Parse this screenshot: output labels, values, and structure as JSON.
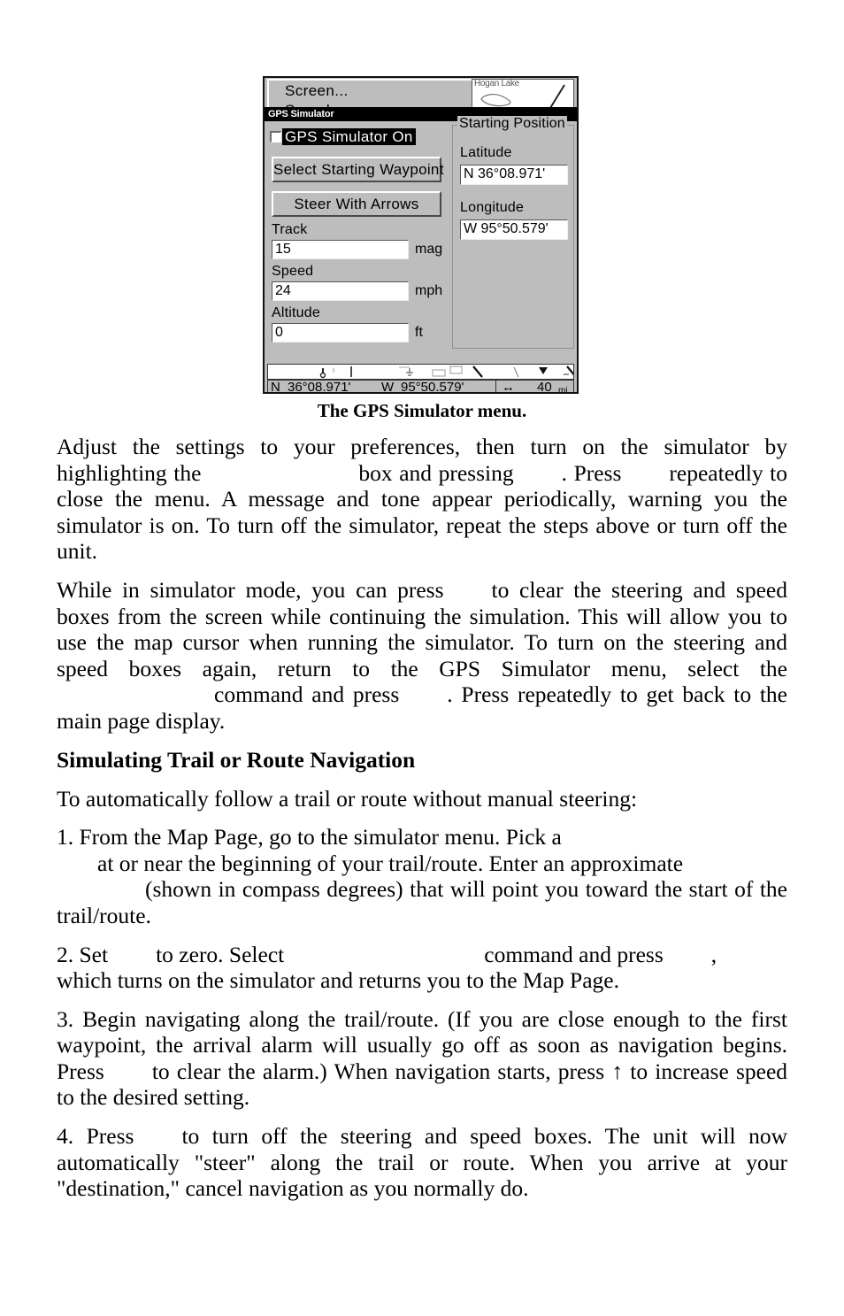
{
  "figure": {
    "background_menu": {
      "items": [
        "Screen...",
        "Sounds..."
      ]
    },
    "map_fragment": {
      "label": "Hogan Lake"
    },
    "dialog": {
      "title": "GPS Simulator",
      "checkbox": {
        "label": "GPS Simulator On",
        "checked": false,
        "highlighted": true
      },
      "buttons": [
        {
          "label": "Select Starting Waypoint"
        },
        {
          "label": "Steer With Arrows"
        }
      ],
      "fields": [
        {
          "label": "Track",
          "value": "15",
          "unit": "mag"
        },
        {
          "label": "Speed",
          "value": "24",
          "unit": "mph"
        },
        {
          "label": "Altitude",
          "value": "0",
          "unit": "ft"
        }
      ],
      "starting_position": {
        "legend": "Starting Position",
        "latitude": {
          "label": "Latitude",
          "value": "N   36°08.971'"
        },
        "longitude": {
          "label": "Longitude",
          "value": "W   95°50.579'"
        }
      }
    },
    "status_bar": {
      "lat_hemisphere": "N",
      "latitude": "36°08.971'",
      "lon_hemisphere": "W",
      "longitude": "95°50.579'",
      "zoom_value": "40",
      "zoom_unit": "mi"
    }
  },
  "caption": "The GPS Simulator menu.",
  "body": {
    "p1_a": "Adjust the settings to your preferences, then turn on the simulator by highlighting the",
    "p1_b": "box and pressing",
    "p1_c": ". Press",
    "p1_d": "repeatedly to close the menu. A message and tone appear periodically, warning you the simulator is on. To turn off the simulator, repeat the steps above or turn off the unit.",
    "p2_a": "While in simulator mode, you can press",
    "p2_b": "to clear the steering and speed boxes from the screen while continuing the simulation. This will allow you to use the map cursor when running the simulator. To turn on the steering and speed boxes again, return to the GPS Simulator menu, select the",
    "p2_c": "command and press",
    "p2_d": ". Press repeatedly to get back to the main page display.",
    "heading": "Simulating Trail or Route Navigation",
    "p3": "To automatically follow a trail or route without manual steering:",
    "item1_a": "1. From the Map Page, go to the simulator menu. Pick a",
    "item1_b": "at or near the beginning of your trail/route. Enter an approximate",
    "item1_c": "(shown in compass degrees) that will point you toward the start of the trail/route.",
    "item2_a": "2. Set",
    "item2_b": "to zero. Select",
    "item2_c": "command and press",
    "item2_d": ",",
    "item2_e": "which turns on the simulator and returns you to the Map Page.",
    "item3_a": "3. Begin navigating along the trail/route. (If you are close enough to the first waypoint, the arrival alarm will usually go off as soon as navigation begins. Press",
    "item3_b": "to clear the alarm.) When navigation starts, press",
    "item3_arrow": "↑",
    "item3_c": "to increase speed to the desired setting.",
    "item4_a": "4. Press",
    "item4_b": "to turn off the steering and speed boxes. The unit will now automatically \"steer\" along the trail or route. When you arrive at your \"destination,\" cancel navigation as you normally do."
  }
}
